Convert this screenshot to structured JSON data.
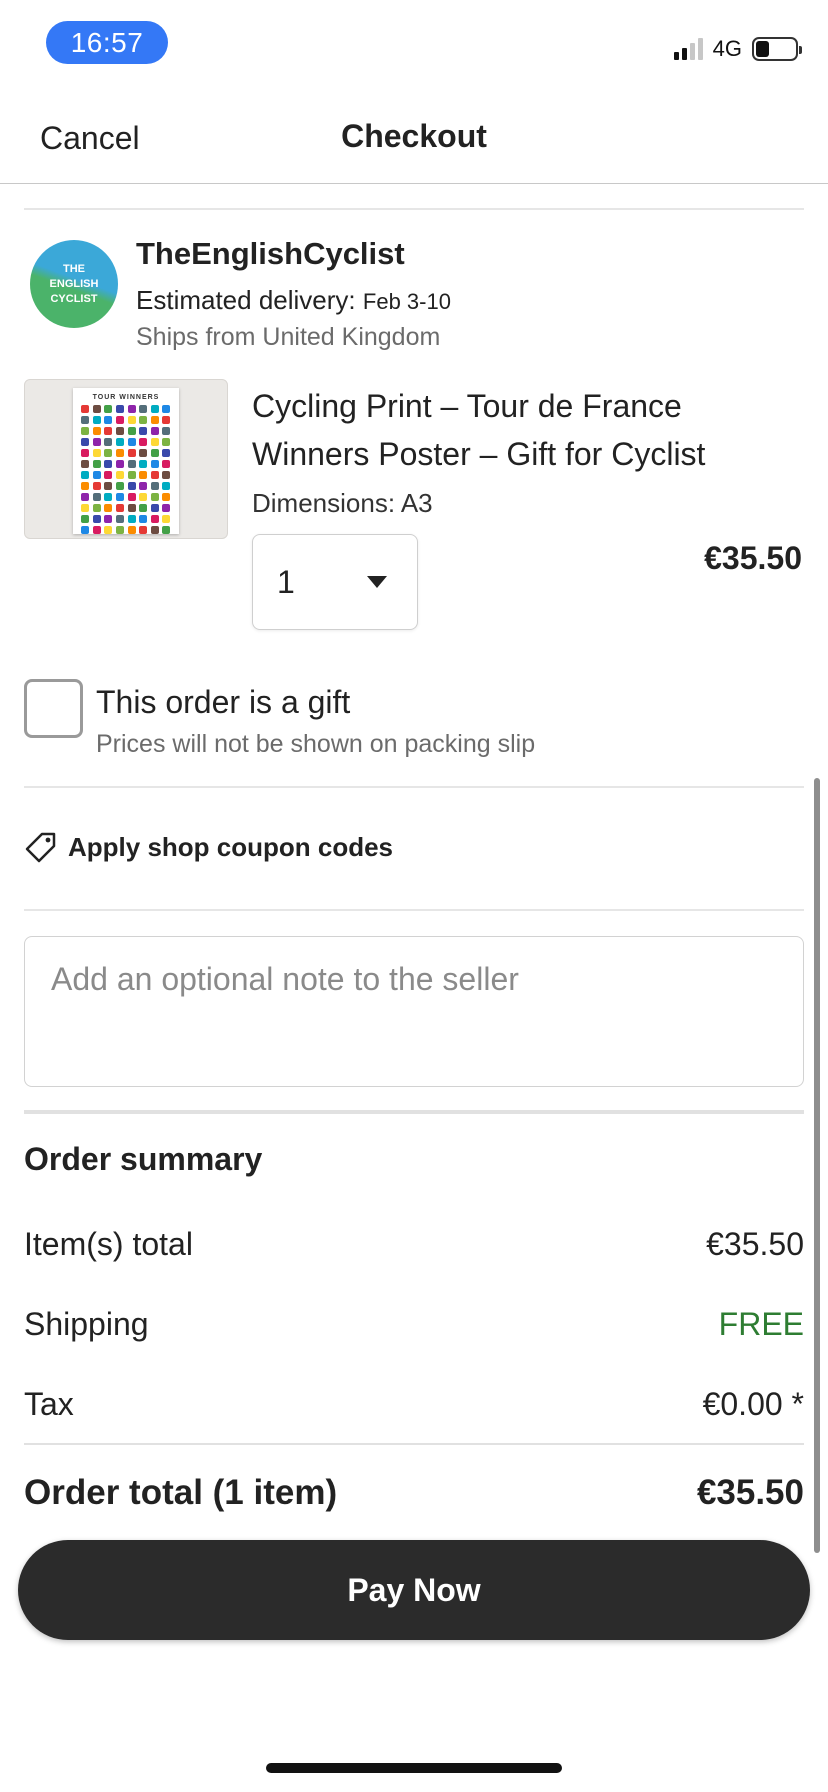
{
  "status_bar": {
    "time": "16:57",
    "network": "4G",
    "signal_bars": 2,
    "signal_max": 4,
    "battery_fraction": 0.35
  },
  "header": {
    "cancel_label": "Cancel",
    "title": "Checkout"
  },
  "shop": {
    "logo_text": [
      "THE",
      "ENGLISH",
      "CYCLIST"
    ],
    "name": "TheEnglishCyclist",
    "delivery_label": "Estimated delivery:",
    "delivery_dates": "Feb 3-10",
    "ships_from": "Ships from United Kingdom"
  },
  "item": {
    "thumbnail_text": "TOUR WINNERS",
    "title": "Cycling Print – Tour de France Winners Poster – Gift for Cyclist",
    "dimensions": "Dimensions: A3",
    "quantity": "1",
    "price": "€35.50"
  },
  "gift": {
    "checked": false,
    "label": "This order is a gift",
    "sublabel": "Prices will not be shown on packing slip"
  },
  "coupon": {
    "icon": "tag-icon",
    "label": "Apply shop coupon codes"
  },
  "note": {
    "value": "",
    "placeholder": "Add an optional note to the seller"
  },
  "summary": {
    "title": "Order summary",
    "rows": [
      {
        "label": "Item(s) total",
        "value": "€35.50"
      },
      {
        "label": "Shipping",
        "value": "FREE"
      },
      {
        "label": "Tax",
        "value": "€0.00 *"
      }
    ],
    "total_label": "Order total (1 item)",
    "total_value": "€35.50"
  },
  "pay_button": {
    "label": "Pay Now"
  },
  "colors": {
    "status_pill": "#3478f6",
    "free_text": "#2e7d32",
    "pay_button": "#2b2b2b"
  }
}
